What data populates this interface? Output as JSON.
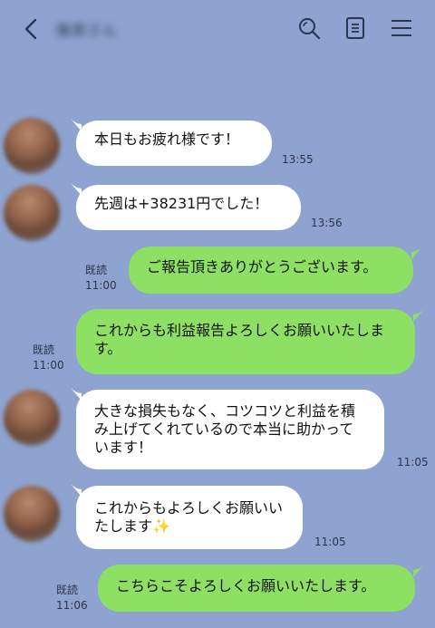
{
  "header": {
    "contact_name": "篠原さん",
    "icons": [
      "back-arrow-icon",
      "search-icon",
      "notes-icon",
      "menu-icon"
    ]
  },
  "colors": {
    "background": "#8ea3cf",
    "incoming_bubble": "#ffffff",
    "outgoing_bubble": "#8ee064"
  },
  "messages": [
    {
      "side": "in",
      "text": "本日もお疲れ様です！",
      "time": "13:55"
    },
    {
      "side": "in",
      "text": "先週は+38231円でした！",
      "time": "13:56"
    },
    {
      "side": "out",
      "text": "ご報告頂きありがとうございます。",
      "read": "既読",
      "time": "11:00"
    },
    {
      "side": "out",
      "text": "これからも利益報告よろしくお願いいたします。",
      "read": "既読",
      "time": "11:00"
    },
    {
      "side": "in",
      "text": "大きな損失もなく、コツコツと利益を積み上げてくれているので本当に助かっています！",
      "time": "11:05"
    },
    {
      "side": "in",
      "text": "これからもよろしくお願いいたします",
      "emoji": "✨",
      "time": "11:05"
    },
    {
      "side": "out",
      "text": "こちらこそよろしくお願いいたします。",
      "read": "既読",
      "time": "11:06"
    }
  ]
}
